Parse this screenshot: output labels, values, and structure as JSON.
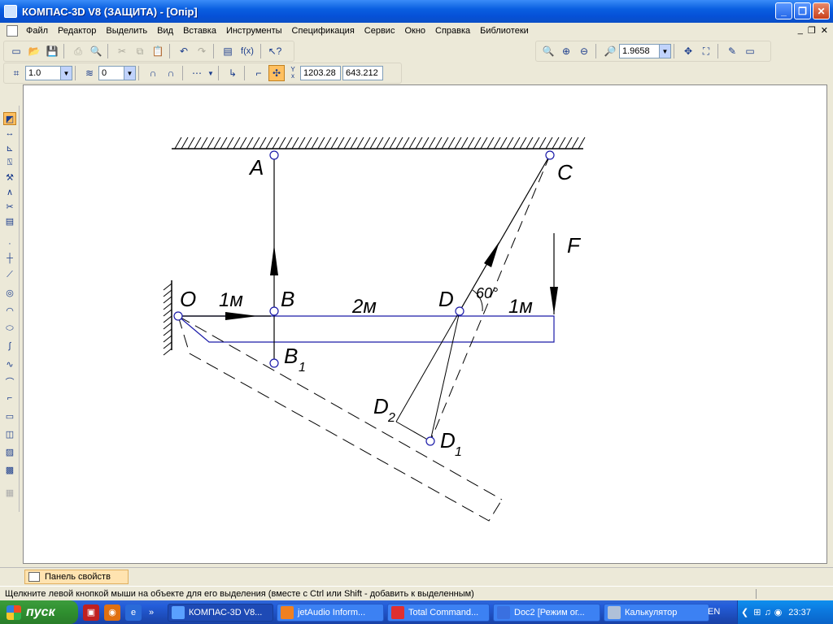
{
  "window": {
    "title": "КОМПАС-3D V8 (ЗАЩИТА) - [Опір]",
    "buttons": {
      "minimize": "_",
      "maximize": "❐",
      "close": "✕"
    }
  },
  "menu": {
    "items": [
      "Файл",
      "Редактор",
      "Выделить",
      "Вид",
      "Вставка",
      "Инструменты",
      "Спецификация",
      "Сервис",
      "Окно",
      "Справка",
      "Библиотеки"
    ],
    "mdi_minimize": "_",
    "mdi_restore": "❐",
    "mdi_close": "✕"
  },
  "toolbar": {
    "zoom_value": "1.9658",
    "style_value": "1.0",
    "layer_value": "0",
    "coord_label_top": "Y",
    "coord_label_bottom": "x",
    "coord_x": "1203.28",
    "coord_y": "643.212",
    "fx_label": "f(x)"
  },
  "drawing": {
    "labels": {
      "A": "A",
      "C": "C",
      "F": "F",
      "O": "O",
      "B": "B",
      "D": "D",
      "B1_main": "B",
      "B1_sub": "1",
      "D1_main": "D",
      "D1_sub": "1",
      "D2_main": "D",
      "D2_sub": "2",
      "len1": "1м",
      "len2": "2м",
      "len3": "1м",
      "angle": "60°"
    },
    "colors": {
      "beam": "#1a1aa8",
      "ink": "#000000"
    }
  },
  "property_panel": {
    "tab_label": "Панель свойств"
  },
  "status": {
    "message": "Щелкните левой кнопкой мыши на объекте для его выделения (вместе с Ctrl или Shift - добавить к выделенным)"
  },
  "taskbar": {
    "start_label": "пуск",
    "tasks": [
      "КОМПАС-3D V8...",
      "jetAudio Inform...",
      "Total Command...",
      "Doc2 [Режим ог...",
      "Калькулятор"
    ],
    "language": "EN",
    "clock": "23:37"
  }
}
